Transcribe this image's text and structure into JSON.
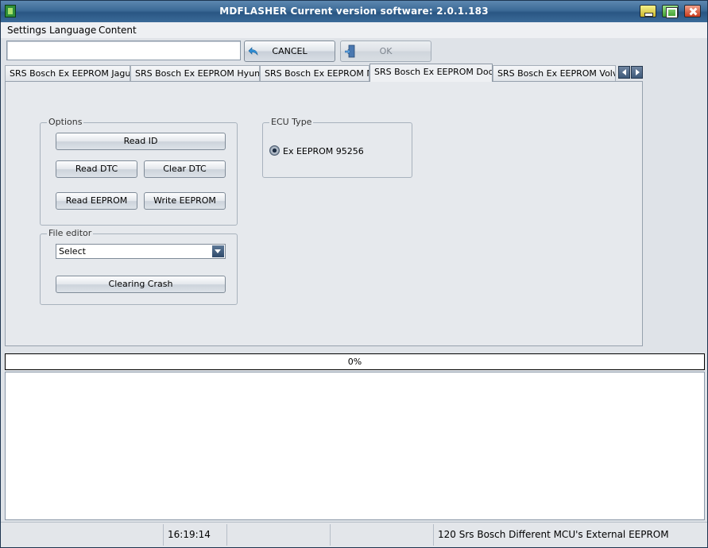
{
  "window": {
    "title": "MDFLASHER  Current version software: 2.0.1.183"
  },
  "menu": [
    "Settings",
    "Language",
    "Content"
  ],
  "toolbar": {
    "input_value": "",
    "cancel_label": "CANCEL",
    "ok_label": "OK"
  },
  "tabs": [
    "SRS Bosch Ex EEPROM Jaguar",
    "SRS Bosch Ex EEPROM Hyundai",
    "SRS Bosch Ex EEPROM MB",
    "SRS Bosch Ex EEPROM Dodge",
    "SRS Bosch Ex EEPROM Volvo"
  ],
  "active_tab": "SRS Bosch Ex EEPROM Dodge",
  "options": {
    "title": "Options",
    "read_id": "Read ID",
    "read_dtc": "Read DTC",
    "clear_dtc": "Clear DTC",
    "read_eeprom": "Read EEPROM",
    "write_eeprom": "Write EEPROM"
  },
  "file_editor": {
    "title": "File editor",
    "select_value": "Select",
    "clearing_crash": "Clearing Crash"
  },
  "ecu_type": {
    "title": "ECU Type",
    "option": "Ex EEPROM 95256",
    "selected": true
  },
  "progress": {
    "value": 0,
    "label": "0%"
  },
  "statusbar": {
    "time": "16:19:14",
    "info": "120 Srs Bosch Different MCU's External EEPROM"
  },
  "colors": {
    "titlebar": "#3c6a96",
    "background": "#dfe3e8"
  }
}
